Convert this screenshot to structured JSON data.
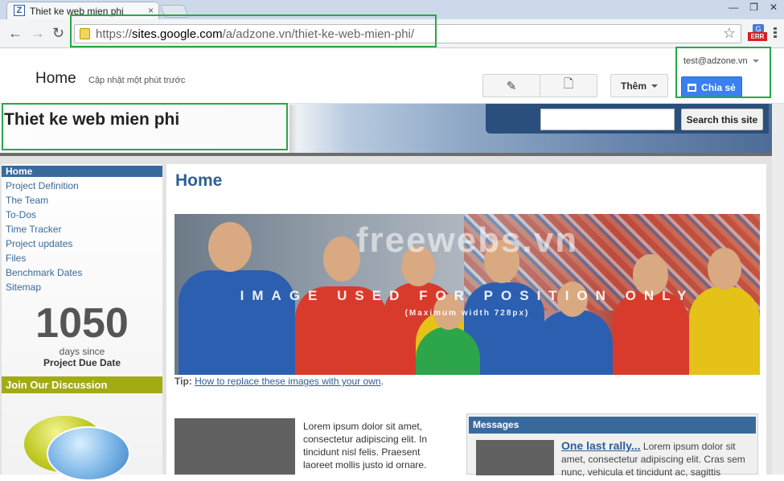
{
  "browser": {
    "tab_title": "Thiet ke web mien phi",
    "favicon_letter": "Z",
    "tab_close": "×",
    "url_prefix": "https://",
    "url_host": "sites.google.com",
    "url_path": "/a/adzone.vn/thiet-ke-web-mien-phi/",
    "window_min": "—",
    "window_max": "❐",
    "window_close": "✕",
    "ext_letter": "G",
    "ext_badge": "ERR"
  },
  "sites_header": {
    "page_name": "Home",
    "updated": "Cập nhật một phút trước",
    "more_label": "Thêm",
    "account": "test@adzone.vn",
    "share_label": "Chia sẻ"
  },
  "banner": {
    "site_title": "Thiet ke web mien phi",
    "search_button": "Search this site",
    "search_placeholder": ""
  },
  "sidebar": {
    "items": [
      {
        "label": "Home"
      },
      {
        "label": "Project Definition"
      },
      {
        "label": "The Team"
      },
      {
        "label": "To-Dos"
      },
      {
        "label": "Time Tracker"
      },
      {
        "label": "Project updates"
      },
      {
        "label": "Files"
      },
      {
        "label": "Benchmark Dates"
      },
      {
        "label": "Sitemap"
      }
    ],
    "countdown_number": "1050",
    "countdown_unit": "days since",
    "countdown_label": "Project Due Date",
    "join_label": "Join Our Discussion"
  },
  "main": {
    "title": "Home",
    "hero_watermark": "freewebs.vn",
    "hero_caption": "IMAGE USED FOR POSITION ONLY",
    "hero_subcaption": "(Maximum width 728px)",
    "tip_label": "Tip:",
    "tip_link": "How to replace these images with your own",
    "tip_end": ".",
    "lorem": "Lorem ipsum dolor sit amet, consectetur adipiscing elit. In tincidunt nisl felis. Praesent laoreet mollis justo id ornare.",
    "messages_header": "Messages",
    "message_link": "One last rally...",
    "message_text": " Lorem ipsum dolor sit amet, consectetur adipiscing elit. Cras sem nunc, vehicula et tincidunt ac, sagittis"
  }
}
